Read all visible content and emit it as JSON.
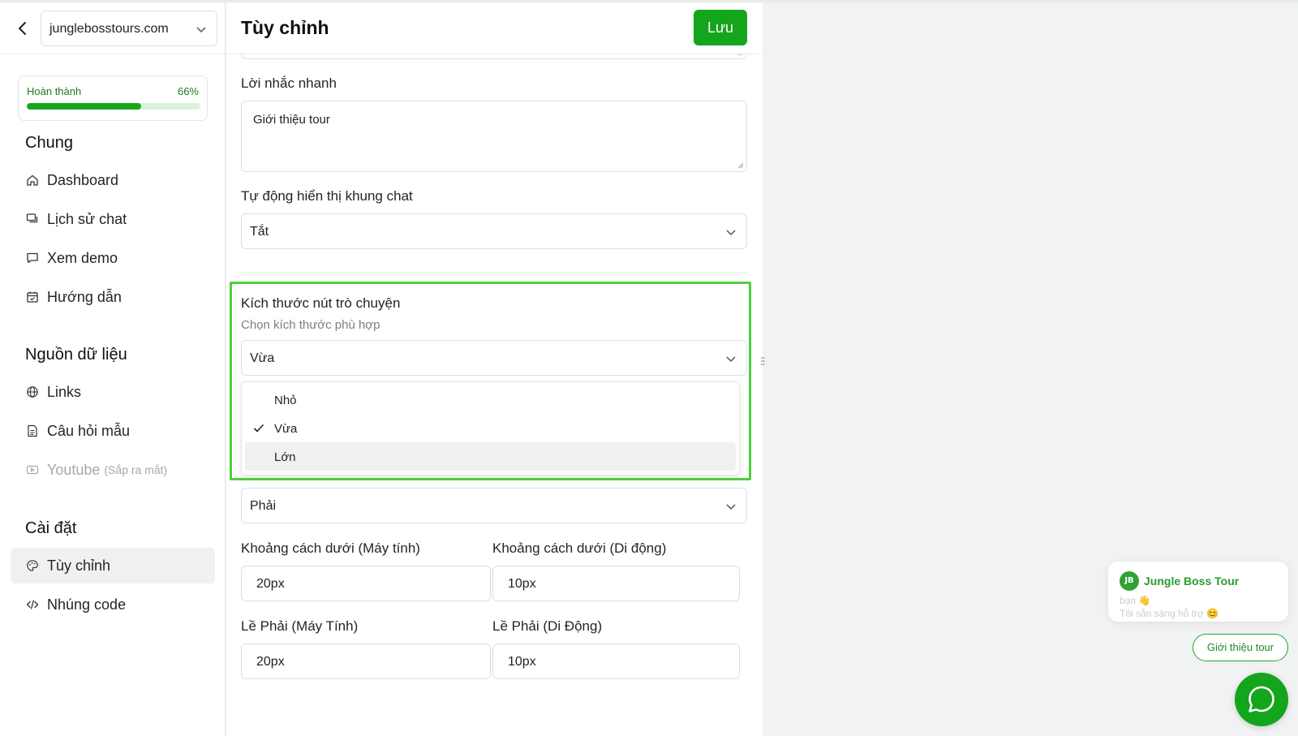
{
  "sidebar": {
    "site_selector": "junglebosstours.com",
    "progress": {
      "label": "Hoàn thành",
      "percent_text": "66%",
      "value": 0.66
    },
    "sections": {
      "general": "Chung",
      "data_sources": "Nguồn dữ liệu",
      "settings": "Cài đặt"
    },
    "items": {
      "dashboard": "Dashboard",
      "chat_history": "Lịch sử chat",
      "demo": "Xem demo",
      "guide": "Hướng dẫn",
      "links": "Links",
      "sample_questions": "Câu hỏi mẫu",
      "youtube": "Youtube",
      "youtube_soon": "(Sắp ra mắt)",
      "customize": "Tùy chỉnh",
      "embed_code": "Nhúng code"
    }
  },
  "header": {
    "title": "Tùy chỉnh",
    "save_label": "Lưu"
  },
  "form": {
    "quick_prompt": {
      "label": "Lời nhắc nhanh",
      "value": "Giới thiệu tour"
    },
    "auto_show": {
      "label": "Tự động hiển thị khung chat",
      "value": "Tắt"
    },
    "button_size": {
      "label": "Kích thước nút trò chuyện",
      "hint": "Chọn kích thước phù hợp",
      "value": "Vừa",
      "options": [
        "Nhỏ",
        "Vừa",
        "Lớn"
      ],
      "selected_index": 1
    },
    "position": {
      "value": "Phải"
    },
    "bottom_desktop": {
      "label": "Khoảng cách dưới (Máy tính)",
      "value": "20px"
    },
    "bottom_mobile": {
      "label": "Khoảng cách dưới (Di động)",
      "value": "10px"
    },
    "right_desktop": {
      "label": "Lề Phải (Máy Tính)",
      "value": "20px"
    },
    "right_mobile": {
      "label": "Lề Phải (Di Động)",
      "value": "10px"
    }
  },
  "widget": {
    "bot_name": "Jungle Boss Tour",
    "logo_text": "JB",
    "preview_line1": "bạn 👋",
    "preview_line2": "Tôi sẵn sàng hỗ trợ 😊",
    "quick_chip": "Giới thiệu tour"
  },
  "colors": {
    "accent": "#13a51b",
    "highlight": "#4cd13c",
    "progress_track": "#dcf1dc"
  },
  "icons": [
    "back-icon",
    "chevron-down-icon",
    "home-icon",
    "chat-history-icon",
    "message-icon",
    "calendar-icon",
    "globe-icon",
    "document-icon",
    "youtube-icon",
    "palette-icon",
    "code-icon",
    "check-icon",
    "whatsapp-chat-icon"
  ]
}
